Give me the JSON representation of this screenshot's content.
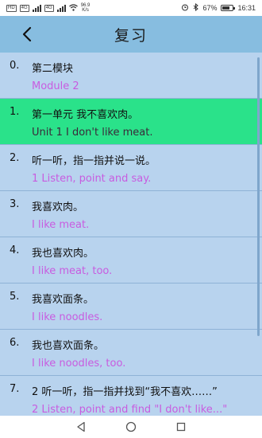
{
  "status_bar": {
    "left_tags": [
      "HD",
      "4G",
      "4G"
    ],
    "speed_top": "96.9",
    "speed_bottom": "K/s",
    "battery": "67%",
    "time": "16:31"
  },
  "header": {
    "title": "复习",
    "back_icon": "chevron-left-icon"
  },
  "items": [
    {
      "num": "0.",
      "zh": "第二模块",
      "en": "Module 2"
    },
    {
      "num": "1.",
      "zh": "第一单元 我不喜欢肉。",
      "en": "Unit 1 I don't like meat."
    },
    {
      "num": "2.",
      "zh": "听一听，指一指并说一说。",
      "en": "1 Listen, point and say."
    },
    {
      "num": "3.",
      "zh": "我喜欢肉。",
      "en": "I like meat."
    },
    {
      "num": "4.",
      "zh": "我也喜欢肉。",
      "en": "I like meat, too."
    },
    {
      "num": "5.",
      "zh": "我喜欢面条。",
      "en": "I like noodles."
    },
    {
      "num": "6.",
      "zh": "我也喜欢面条。",
      "en": "I like noodles, too."
    },
    {
      "num": "7.",
      "zh": "2 听一听，指一指并找到“我不喜欢……”",
      "en": "2 Listen, point and find \"I don't like...\""
    }
  ],
  "colors": {
    "header": "#87bde0",
    "list_bg": "#b8d3ee",
    "active_row": "#2ae28a",
    "english_text": "#c85ce0"
  },
  "active_index": 1
}
